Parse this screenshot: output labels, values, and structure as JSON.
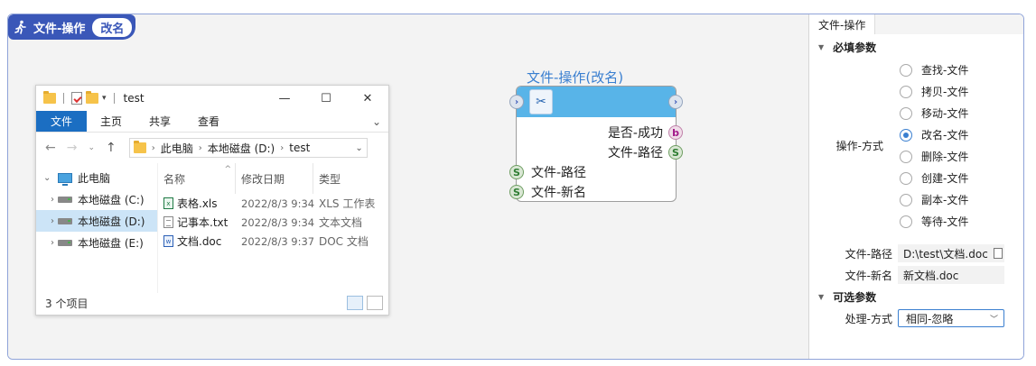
{
  "header": {
    "title": "文件-操作",
    "badge": "改名"
  },
  "explorer": {
    "window_title": "test",
    "ribbon_tabs": [
      "文件",
      "主页",
      "共享",
      "查看"
    ],
    "address_crumbs": [
      "此电脑",
      "本地磁盘 (D:)",
      "test"
    ],
    "nav_items": [
      {
        "label": "此电脑",
        "icon": "pc-icon"
      },
      {
        "label": "本地磁盘 (C:)",
        "icon": "drive-icon"
      },
      {
        "label": "本地磁盘 (D:)",
        "icon": "drive-icon",
        "selected": true
      },
      {
        "label": "本地磁盘 (E:)",
        "icon": "drive-icon"
      }
    ],
    "columns": [
      "名称",
      "修改日期",
      "类型"
    ],
    "files": [
      {
        "name": "表格.xls",
        "date": "2022/8/3 9:34",
        "type": "XLS 工作表",
        "icon": "xls-file-icon"
      },
      {
        "name": "记事本.txt",
        "date": "2022/8/3 9:34",
        "type": "文本文档",
        "icon": "txt-file-icon"
      },
      {
        "name": "文档.doc",
        "date": "2022/8/3 9:37",
        "type": "DOC 文档",
        "icon": "doc-file-icon"
      }
    ],
    "status": "3 个项目"
  },
  "node": {
    "title": "文件-操作(改名)",
    "outputs": [
      {
        "label": "是否-成功",
        "port": "b"
      },
      {
        "label": "文件-路径",
        "port": "S"
      }
    ],
    "inputs": [
      {
        "label": "文件-路径",
        "port": "S"
      },
      {
        "label": "文件-新名",
        "port": "S"
      }
    ]
  },
  "props": {
    "tab": "文件-操作",
    "required_title": "必填参数",
    "operation_label": "操作-方式",
    "operations": [
      "查找-文件",
      "拷贝-文件",
      "移动-文件",
      "改名-文件",
      "删除-文件",
      "创建-文件",
      "副本-文件",
      "等待-文件"
    ],
    "selected_operation": "改名-文件",
    "path_label": "文件-路径",
    "path_value": "D:\\test\\文档.doc",
    "newname_label": "文件-新名",
    "newname_value": "新文档.doc",
    "optional_title": "可选参数",
    "handling_label": "处理-方式",
    "handling_value": "相同-忽略"
  }
}
